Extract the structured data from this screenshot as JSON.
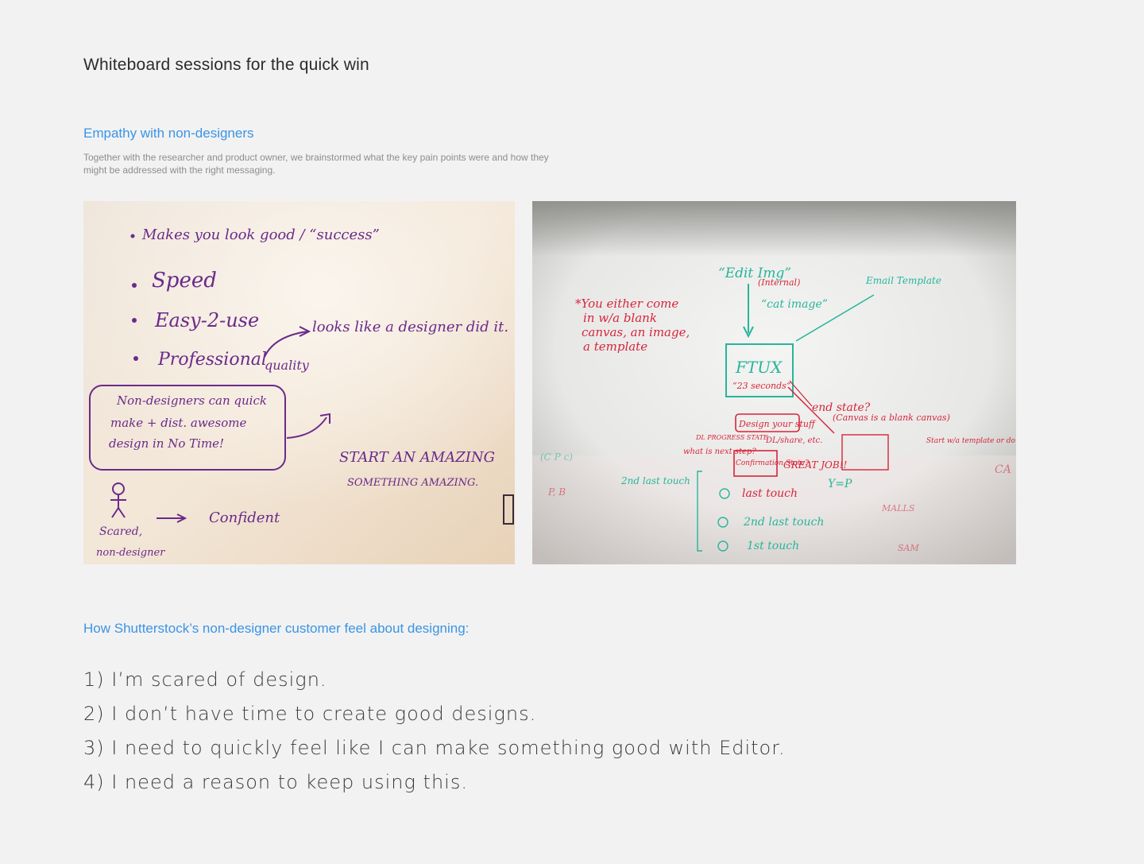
{
  "page": {
    "title": "Whiteboard sessions for the quick win"
  },
  "section": {
    "heading": "Empathy with non-designers",
    "description": "Together with the researcher and product owner, we brainstormed what the key pain points were and how they might be addressed with the right messaging."
  },
  "whiteboard_1": {
    "line_1": "Makes you look good / “success”",
    "line_2": "Speed",
    "line_3": "Easy-2-use",
    "line_4": "Professional",
    "line_5": "quality",
    "line_6": "looks like a designer did it.",
    "box_line_1": "Non-designers can quick",
    "box_line_2": "make + dist. awesome",
    "box_line_3": "design in No Time!",
    "start_1": "START AN AMAZING",
    "start_2": "SOMETHING AMAZING.",
    "confident": "Confident",
    "scared": "Scared,",
    "non_designer": "non-designer"
  },
  "whiteboard_2": {
    "you_1": "*You either come",
    "you_2": "in w/a blank",
    "you_3": "canvas, an image,",
    "you_4": "a template",
    "edit_img": "“Edit Img”",
    "internal": "(Internal)",
    "cat_image": "“cat image”",
    "email_template": "Email Template",
    "ftux": "FTUX",
    "seconds": "“23 seconds”",
    "end_state": "end state?",
    "canvas_blank": "(Canvas is a blank canvas)",
    "design_your_stuff": "Design your stuff",
    "dl_share": "DL/share, etc.",
    "confirmation_state": "Confirmation State?",
    "great_job": "GREAT JOB!!",
    "what_next": "what is next step?",
    "start_template": "Start w/a template or do image search",
    "last_touch": "last touch",
    "second_last": "2nd last touch",
    "first_touch": "1st touch",
    "dl_progress": "DL PROGRESS STATE",
    "y_p": "Y=P"
  },
  "feel": {
    "heading": "How Shutterstock’s non-designer customer feel about designing:",
    "items": [
      "1) I’m scared of design.",
      "2) I don’t have time to create good designs.",
      "3) I need to quickly feel like I can make something good with Editor.",
      "4) I need a reason to keep using this."
    ]
  }
}
